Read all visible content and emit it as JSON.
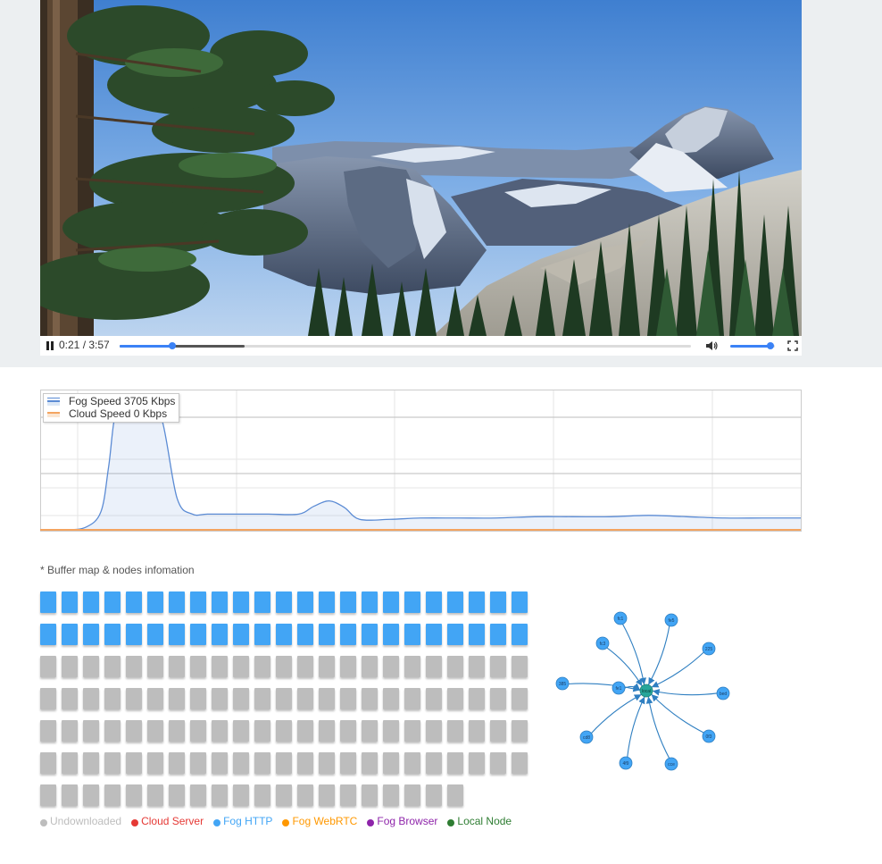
{
  "player": {
    "play_state": "playing",
    "current_time": "0:21",
    "duration": "3:57",
    "time_text": "0:21 / 3:57",
    "progress": 0.092,
    "buffered": 0.218,
    "volume": 0.9,
    "icons": [
      "pause-icon",
      "volume-icon",
      "fullscreen-icon"
    ]
  },
  "speed_chart": {
    "legend": [
      {
        "label": "Fog Speed 3705 Kbps",
        "color": "#5b8bd4"
      },
      {
        "label": "Cloud Speed 0 Kbps",
        "color": "#f4a460"
      }
    ]
  },
  "chart_data": {
    "type": "area",
    "x": [
      0,
      3,
      6,
      8,
      9,
      10,
      12,
      14,
      16,
      18,
      20,
      22,
      26,
      30,
      34,
      36,
      38,
      40,
      42,
      46,
      50,
      55,
      60,
      65,
      70,
      75,
      80,
      85,
      90,
      95,
      100
    ],
    "series": [
      {
        "name": "Fog Speed",
        "values": [
          0,
          0,
          2,
          14,
          48,
          90,
          96,
          96,
          84,
          24,
          12,
          12,
          12,
          12,
          12,
          18,
          22,
          17,
          8,
          8,
          9,
          9,
          9,
          10,
          10,
          10,
          11,
          10,
          9,
          9,
          9
        ]
      },
      {
        "name": "Cloud Speed",
        "values": [
          0,
          0,
          0,
          0,
          0,
          0,
          0,
          0,
          0,
          0,
          0,
          0,
          0,
          0,
          0,
          0,
          0,
          0,
          0,
          0,
          0,
          0,
          0,
          0,
          0,
          0,
          0,
          0,
          0,
          0,
          0
        ]
      }
    ],
    "ylim": [
      0,
      100
    ],
    "grid": true,
    "legend_position": "top-left"
  },
  "buffer_map": {
    "label": "* Buffer map & nodes infomation",
    "blocks": "FFFFFFFFFFFFFFFFFFFFFFFFFFFFFFFFFFFFFFFFFFFFFFUUUUUUUUUUUUUUUUUUUUUUUUUUUUUUUUUUUUUUUUUUUUUUUUUUUUUUUUUUUUUUUUUUUUUUUUUUUUUUUUUUUUUUUUUUUUUUUUUUUUUUUUUUUUUUUU",
    "columns": 23,
    "colors": {
      "U": "#bdbdbd",
      "F": "#42a5f5"
    }
  },
  "legend_key": [
    {
      "label": "Undownloaded",
      "color": "#bdbdbd"
    },
    {
      "label": "Cloud Server",
      "color": "#e53935"
    },
    {
      "label": "Fog HTTP",
      "color": "#42a5f5"
    },
    {
      "label": "Fog WebRTC",
      "color": "#ff9800"
    },
    {
      "label": "Fog Browser",
      "color": "#8e24aa"
    },
    {
      "label": "Local Node",
      "color": "#2e7d32"
    }
  ],
  "node_graph": {
    "center": {
      "label": "local",
      "color": "#26a69a"
    },
    "peers": [
      {
        "label": "fc1"
      },
      {
        "label": "fe5"
      },
      {
        "label": "fc3"
      },
      {
        "label": "225"
      },
      {
        "label": "385"
      },
      {
        "label": "fe1"
      },
      {
        "label": "bed"
      },
      {
        "label": "cd8"
      },
      {
        "label": "0f3"
      },
      {
        "label": "4f9"
      },
      {
        "label": "cce"
      }
    ],
    "peer_color": "#42a5f5",
    "edge_color": "#2f7fc1"
  }
}
